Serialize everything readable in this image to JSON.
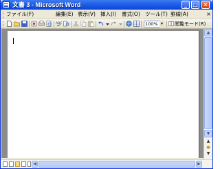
{
  "window": {
    "title": "文書 3 - Microsoft Word",
    "minimize_glyph": "_",
    "maximize_glyph": "□",
    "close_glyph": "×"
  },
  "menubar": {
    "items": [
      {
        "label": "ファイル(F)"
      },
      {
        "label": "編集(E)"
      },
      {
        "label": "表示(V)"
      },
      {
        "label": "挿入(I)"
      },
      {
        "label": "書式(O)"
      },
      {
        "label": "ツール(T)"
      },
      {
        "label": "罫線(A)"
      }
    ],
    "close_glyph": "×"
  },
  "toolbar": {
    "zoom_value": "100%",
    "zoom_arrow": "▾",
    "reading_mode_label": "閲覧モード(R)"
  },
  "scrollbar": {
    "up": "▲",
    "down": "▼",
    "left": "◀",
    "right": "▶",
    "prev_page": "▲",
    "browse_object": "●",
    "next_page": "▼"
  },
  "colors": {
    "titlebar": "#1f5ee8",
    "document_background": "#8c8c8c",
    "page": "#ffffff"
  }
}
